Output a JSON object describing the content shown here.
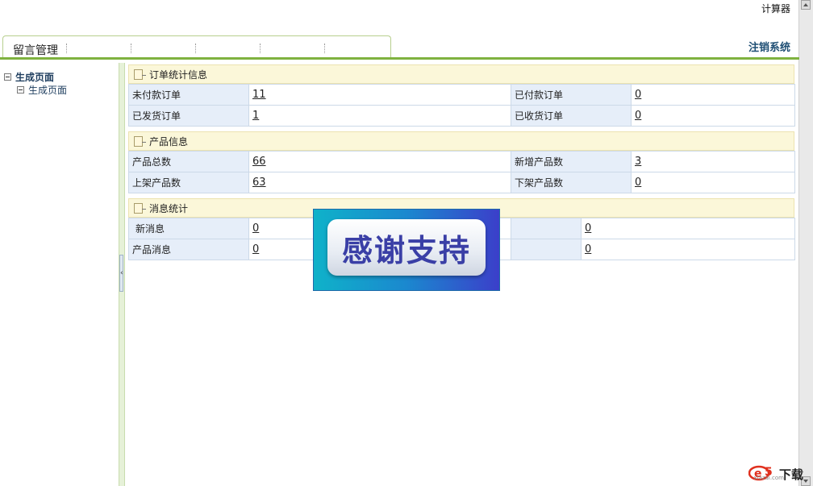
{
  "top": {
    "calculator_link": "计算器",
    "logout_link": "注销系统"
  },
  "tabs": [
    {
      "label": "留言管理"
    }
  ],
  "sidebar": {
    "root_label": "生成页面",
    "children": [
      {
        "label": "生成页面"
      }
    ]
  },
  "sections": {
    "orders": {
      "title": "订单统计信息",
      "rows": [
        {
          "l1": "未付款订单",
          "v1": "11",
          "l2": "已付款订单",
          "v2": "0"
        },
        {
          "l1": "已发货订单",
          "v1": "1",
          "l2": "已收货订单",
          "v2": "0"
        }
      ]
    },
    "products": {
      "title": "产品信息",
      "rows": [
        {
          "l1": "产品总数",
          "v1": "66",
          "l2": "新增产品数",
          "v2": "3"
        },
        {
          "l1": "上架产品数",
          "v1": "63",
          "l2": "下架产品数",
          "v2": "0"
        }
      ]
    },
    "messages": {
      "title": "消息统计",
      "rows": [
        {
          "l1": "新消息",
          "v1": "0",
          "v2": "0"
        },
        {
          "l1": "产品消息",
          "v1": "0",
          "v2": "0"
        }
      ]
    }
  },
  "overlay": {
    "text": "感谢支持"
  },
  "watermark": {
    "brand": "下载",
    "domain": "xiazai.com"
  }
}
